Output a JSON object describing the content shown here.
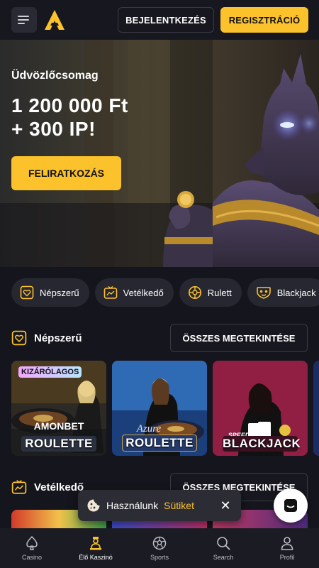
{
  "header": {
    "login_label": "BEJELENTKEZÉS",
    "register_label": "REGISZTRÁCIÓ"
  },
  "hero": {
    "welcome": "Üdvözlőcsomag",
    "amount_line1": "1 200 000 Ft",
    "amount_line2": "+ 300 IP!",
    "cta_label": "FELIRATKOZÁS"
  },
  "chips": [
    {
      "label": "Népszerű",
      "icon": "heart-icon"
    },
    {
      "label": "Vetélkedő",
      "icon": "tv-chart-icon"
    },
    {
      "label": "Rulett",
      "icon": "roulette-icon"
    },
    {
      "label": "Blackjack",
      "icon": "cards-icon"
    }
  ],
  "sections": {
    "popular": {
      "title": "Népszerű",
      "see_all": "ÖSSZES MEGTEKINTÉSE"
    },
    "quiz": {
      "title": "Vetélkedő",
      "see_all": "ÖSSZES MEGTEKINTÉSE"
    }
  },
  "games": [
    {
      "badge": "KIZÁRÓLAGOS",
      "brand": "AMONBET",
      "title": "ROULETTE"
    },
    {
      "brand": "Azure",
      "title": "ROULETTE"
    },
    {
      "brand": "SPEED",
      "title": "BLACKJACK"
    }
  ],
  "cookie": {
    "text": "Használunk",
    "link": "Sütiket",
    "close": "✕"
  },
  "nav": [
    {
      "label": "Casino",
      "icon": "spade-icon"
    },
    {
      "label": "Élő Kaszinó",
      "icon": "dealer-icon",
      "active": true
    },
    {
      "label": "Sports",
      "icon": "soccer-ball-icon"
    },
    {
      "label": "Search",
      "icon": "search-icon"
    },
    {
      "label": "Profil",
      "icon": "user-icon"
    }
  ],
  "colors": {
    "accent": "#fcc22b",
    "background": "#15151d",
    "chip": "#272731"
  }
}
